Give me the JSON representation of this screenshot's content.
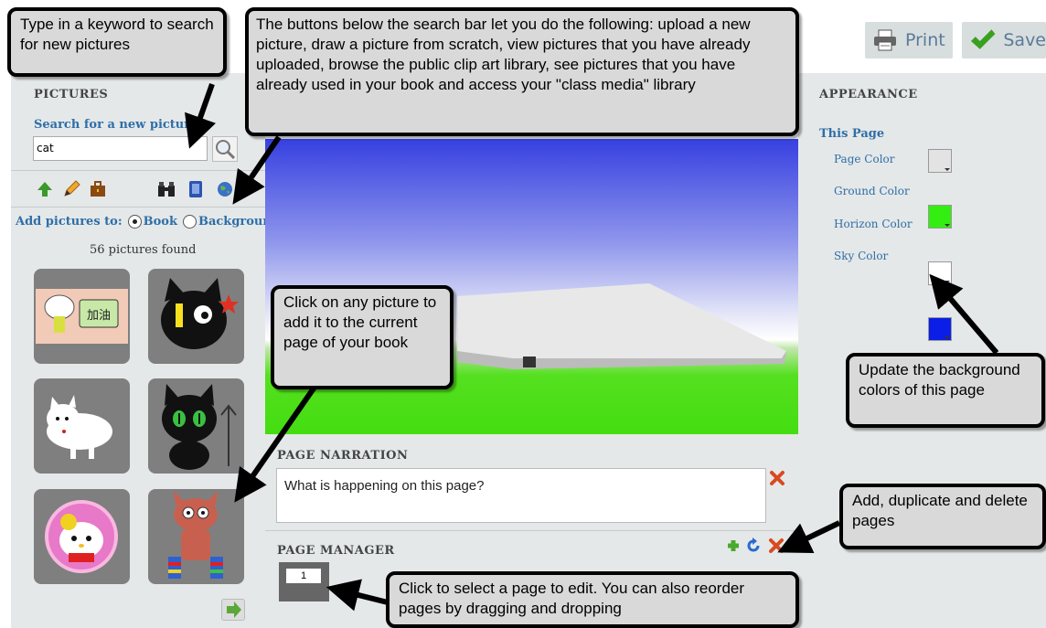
{
  "toolbar": {
    "print_label": "Print",
    "save_label": "Save"
  },
  "pictures": {
    "title": "PICTURES",
    "search_label": "Search for a new picture",
    "search_value": "cat",
    "add_to_label": "Add pictures to:",
    "option_book": "Book",
    "option_background": "Background",
    "found_count": "56 pictures found"
  },
  "narration": {
    "title": "PAGE NARRATION",
    "placeholder": "What is happening on this page?"
  },
  "page_manager": {
    "title": "PAGE MANAGER",
    "pages": [
      "1"
    ]
  },
  "appearance": {
    "title": "APPEARANCE",
    "subtitle": "This Page",
    "colors": [
      {
        "label": "Page Color",
        "value": "#e3e3e3"
      },
      {
        "label": "Ground Color",
        "value": "#33ee11"
      },
      {
        "label": "Horizon Color",
        "value": "#ffffff"
      },
      {
        "label": "Sky Color",
        "value": "#0a1ee8"
      }
    ]
  },
  "callouts": {
    "keyword": "Type in a keyword to search for new pictures",
    "buttons": "The buttons below the search bar let you do the following: upload a new picture, draw a picture from scratch, view pictures that you have already uploaded, browse the public clip art library, see pictures that you have already used in your book and access your \"class media\" library",
    "click_picture": "Click on any picture to add it to the current page of your book",
    "background": "Update the background colors of this page",
    "pages": "Add, duplicate and delete pages",
    "select_page": "Click to select a page to edit.  You can also reorder pages by dragging and dropping"
  },
  "icons": [
    "upload-icon",
    "pencil-icon",
    "briefcase-icon",
    "binoculars-icon",
    "book-icon",
    "globe-icon",
    "next-arrow-icon",
    "add-page-icon",
    "duplicate-page-icon",
    "delete-page-icon",
    "delete-narration-icon",
    "printer-icon",
    "check-icon",
    "magnifier-icon"
  ]
}
